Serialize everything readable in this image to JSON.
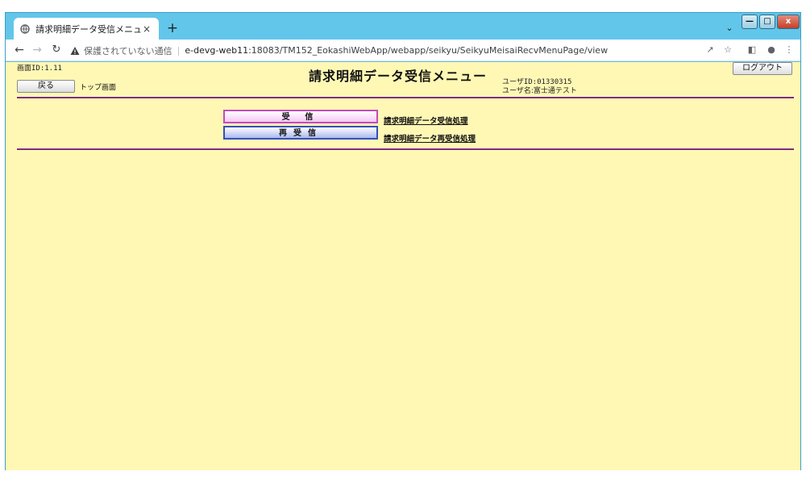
{
  "browser": {
    "tab_title": "請求明細データ受信メニュー",
    "tab_close": "×",
    "new_tab": "+",
    "security_label": "保護されていない通信",
    "url_host": "e-devg-web11",
    "url_rest": ":18083/TM152_EokashiWebApp/webapp/seikyu/SeikyuMeisaiRecvMenuPage/view"
  },
  "page": {
    "screen_id": "画面ID:1.11",
    "title": "請求明細データ受信メニュー",
    "logout_label": "ログアウト",
    "back_label": "戻る",
    "top_link": "トップ画面",
    "user_id": "ユーザID:01330315",
    "user_name": "ユーザ名:富士通テスト"
  },
  "menu": [
    {
      "button_label": "受 信",
      "link_label": "請求明細データ受信処理"
    },
    {
      "button_label": "再受信",
      "link_label": "請求明細データ再受信処理"
    }
  ],
  "colors": {
    "page_background": "#fff8b5",
    "rule": "#7a2f86",
    "receive_border": "#c24bc2",
    "rereceive_border": "#3550b8",
    "window_frame": "#62c6ea"
  }
}
